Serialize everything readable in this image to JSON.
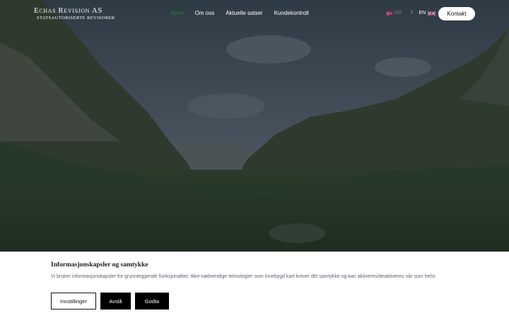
{
  "brand": {
    "name": "Echas Revisjon AS",
    "tagline": "Statsautoriserte Revisorer"
  },
  "nav": {
    "items": [
      "Hjem",
      "Om oss",
      "Aktuelle satser",
      "Kundekontroll"
    ],
    "active": "Hjem"
  },
  "language": {
    "options": [
      "NO",
      "EN"
    ],
    "separator": "/",
    "active": "EN"
  },
  "contact_label": "Kontakt",
  "hero": {
    "image": "mountain-valley-forest-photo"
  },
  "cookie_banner": {
    "title": "Informasjonskapsler og samtykke",
    "text": "Vi bruker informasjonskapsler for grunnleggende funksjonalitet. Ikke-nødvendige teknologier som innebygd kart krever ditt samtykke og kan aktiveres/deaktiveres når som helst.",
    "buttons": {
      "settings": "Innstillinger",
      "decline": "Avslå",
      "accept": "Godta"
    }
  },
  "colors": {
    "active_nav": "#2e7d3b",
    "banner_bg": "#ffffff",
    "button_dark": "#000000"
  }
}
